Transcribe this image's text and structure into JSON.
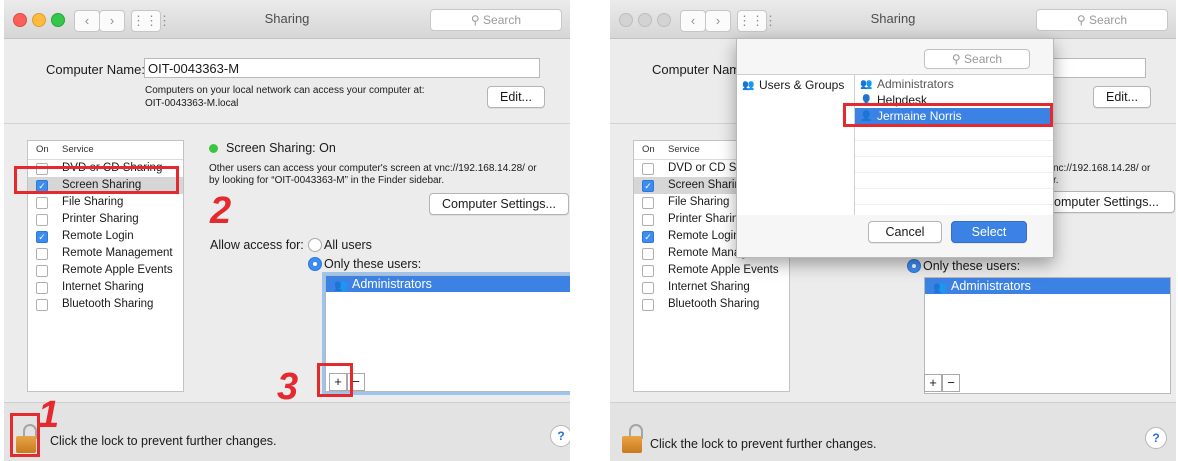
{
  "title": "Sharing",
  "search_placeholder": "Search",
  "computer_name_label": "Computer Name:",
  "computer_name_value": "OIT-0043363-M",
  "network_line1": "Computers on your local network can access your computer at:",
  "network_line2": "OIT-0043363-M.local",
  "edit_button": "Edit...",
  "service_col_on": "On",
  "service_col_service": "Service",
  "services": [
    {
      "label": "DVD or CD Sharing",
      "checked": false
    },
    {
      "label": "Screen Sharing",
      "checked": true
    },
    {
      "label": "File Sharing",
      "checked": false
    },
    {
      "label": "Printer Sharing",
      "checked": false
    },
    {
      "label": "Remote Login",
      "checked": true
    },
    {
      "label": "Remote Management",
      "checked": false
    },
    {
      "label": "Remote Apple Events",
      "checked": false
    },
    {
      "label": "Internet Sharing",
      "checked": false
    },
    {
      "label": "Bluetooth Sharing",
      "checked": false
    }
  ],
  "status_text": "Screen Sharing: On",
  "desc_line1": "Other users can access your computer's screen at vnc://192.168.14.28/ or",
  "desc_line2": "by looking for “OIT-0043363-M” in the Finder sidebar.",
  "desc_line1_trunc": "nc://192.168.14.28/ or",
  "desc_line2_trunc": "r.",
  "computer_settings_button": "Computer Settings...",
  "computer_settings_trunc": "omputer Settings...",
  "allow_access_label": "Allow access for:",
  "all_users_option": "All users",
  "only_these_users_option": "Only these users:",
  "allowed_users": [
    "Administrators"
  ],
  "plus_label": "+",
  "minus_label": "−",
  "lock_text": "Click the lock to prevent further changes.",
  "help_label": "?",
  "annotations": {
    "step1": "1",
    "step2": "2",
    "step3": "3"
  },
  "sheet": {
    "search_placeholder": "Search",
    "left_item": "Users & Groups",
    "right_items": [
      "Administrators",
      "Helpdesk",
      "Jermaine Norris"
    ],
    "cancel_button": "Cancel",
    "select_button": "Select"
  },
  "colors": {
    "accent": "#3c82e4",
    "annotation_red": "#e42a2f",
    "status_green": "#3ac740"
  }
}
